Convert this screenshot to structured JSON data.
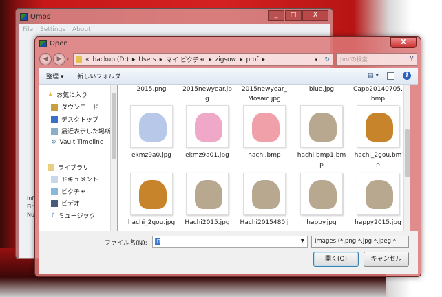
{
  "qmos": {
    "title": "Qmos",
    "menu": [
      "File",
      "Settings",
      "About"
    ],
    "info": [
      "Inf",
      "Fir",
      "Nu"
    ],
    "buttons": {
      "min": "_",
      "max": "□",
      "close": "X"
    }
  },
  "dialog": {
    "title": "Open",
    "close": "X",
    "address": {
      "prefix": "«",
      "path": [
        "backup (D:)",
        "Users",
        "マイ ピクチャ",
        "zigsow",
        "prof"
      ]
    },
    "search_placeholder": "profの検索",
    "toolbar": {
      "organize": "整理 ▾",
      "new_folder": "新しいフォルダー"
    },
    "nav": {
      "favorites": "お気に入り",
      "fav_items": [
        "ダウンロード",
        "デスクトップ",
        "最近表示した場所",
        "Vault Timeline"
      ],
      "libraries": "ライブラリ",
      "lib_items": [
        "ドキュメント",
        "ピクチャ",
        "ビデオ",
        "ミュージック"
      ]
    },
    "files_top_display": [
      [
        "2015.png",
        ""
      ],
      [
        "2015newyear.jp",
        "g"
      ],
      [
        "2015newyear_",
        "Mosaic.jpg"
      ],
      [
        "blue.jpg",
        ""
      ],
      [
        "Capb20140705.",
        "bmp"
      ]
    ],
    "files": [
      {
        "name": [
          "ekmz9a0.jpg",
          ""
        ],
        "color": "#b8c8e8"
      },
      {
        "name": [
          "ekmz9a01.jpg",
          ""
        ],
        "color": "#f0a8c8"
      },
      {
        "name": [
          "hachi.bmp",
          ""
        ],
        "color": "#f0a0a8"
      },
      {
        "name": [
          "hachi.bmp1.bm",
          "p"
        ],
        "color": "#b8a890"
      },
      {
        "name": [
          "hachi_2gou.bm",
          "p"
        ],
        "color": "#c8842a"
      },
      {
        "name": [
          "hachi_2gou.jpg",
          ""
        ],
        "color": "#c8842a"
      },
      {
        "name": [
          "Hachi2015.jpg",
          ""
        ],
        "color": "#b8a890"
      },
      {
        "name": [
          "Hachi2015480.j",
          ""
        ],
        "color": "#b8a890"
      },
      {
        "name": [
          "happy.jpg",
          ""
        ],
        "color": "#b8a890"
      },
      {
        "name": [
          "happy2015.jpg",
          ""
        ],
        "color": "#b8a890"
      }
    ],
    "filename_label": "ファイル名(N):",
    "filename_value": "In",
    "filter": "Images (*.png *.jpg *.jpeg *",
    "open": "開く(O)",
    "cancel": "キャンセル"
  }
}
